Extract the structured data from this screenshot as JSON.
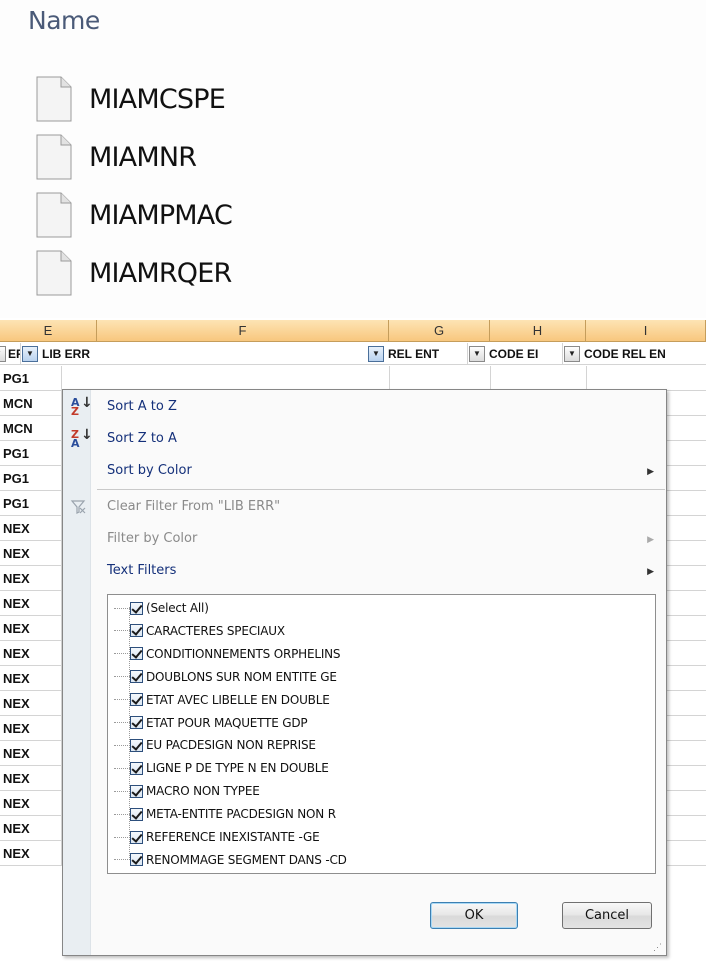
{
  "explorer": {
    "column_header": "Name",
    "files": [
      "MIAMCSPE",
      "MIAMNR",
      "MIAMPMAC",
      "MIAMRQER"
    ]
  },
  "sheet": {
    "column_letters": [
      "E",
      "F",
      "G",
      "H",
      "I"
    ],
    "field_headers": {
      "e": "ERR",
      "f": "LIB ERR",
      "g": "REL ENT",
      "h": "CODE EI",
      "i": "CODE REL EN"
    },
    "column_e_values": [
      "PG1",
      "MCN",
      "MCN",
      "PG1",
      "PG1",
      "PG1",
      "NEX",
      "NEX",
      "NEX",
      "NEX",
      "NEX",
      "NEX",
      "NEX",
      "NEX",
      "NEX",
      "NEX",
      "NEX",
      "NEX",
      "NEX",
      "NEX"
    ]
  },
  "filter_menu": {
    "sort_a_z": "Sort A to Z",
    "sort_z_a": "Sort Z to A",
    "sort_by_color": "Sort by Color",
    "clear_filter": "Clear Filter From \"LIB ERR\"",
    "filter_by_color": "Filter by Color",
    "text_filters": "Text Filters",
    "sort_az_icon_top": "A",
    "sort_az_icon_bottom": "Z",
    "sort_za_icon_top": "Z",
    "sort_za_icon_bottom": "A",
    "values": [
      "(Select All)",
      "CARACTERES SPECIAUX",
      "CONDITIONNEMENTS ORPHELINS",
      "DOUBLONS SUR NOM ENTITE GE",
      "ETAT AVEC LIBELLE EN DOUBLE",
      "ETAT POUR MAQUETTE GDP",
      "EU PACDESIGN NON REPRISE",
      "LIGNE P DE TYPE N EN DOUBLE",
      "MACRO NON TYPEE",
      "META-ENTITE PACDESIGN NON R",
      "REFERENCE INEXISTANTE -GE",
      "RENOMMAGE SEGMENT DANS -CD"
    ],
    "ok_label": "OK",
    "cancel_label": "Cancel"
  },
  "colors": {
    "column_header_bg": "#f8c77e",
    "menu_link_text": "#14307a",
    "disabled_text": "#8a8a8a"
  }
}
